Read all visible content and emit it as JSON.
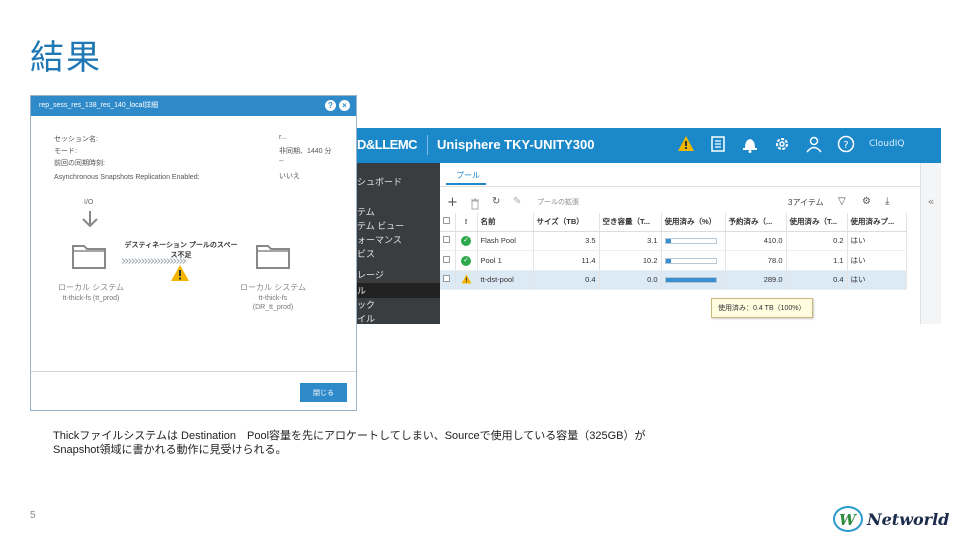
{
  "slide": {
    "title": "結果",
    "page_number": "5",
    "body_line1": "Thickファイルシステムは Destination　Pool容量を先にアロケートしてしまい、Sourceで使用している容量（325GB）が",
    "body_line2": "Snapshot領域に書かれる動作に見受けられる。",
    "logo_text": "Networld"
  },
  "dialog": {
    "title": "rep_sess_res_138_res_140_local詳細",
    "help_icon": "help-icon",
    "close_icon": "close-icon",
    "fields": [
      {
        "label": "セッション名:",
        "value": "r..."
      },
      {
        "label": "モード:",
        "value": "非同期、1440 分"
      },
      {
        "label": "前回の同期時刻:",
        "value": "--"
      },
      {
        "label": "Asynchronous Snapshots Replication Enabled:",
        "value": "いいえ"
      }
    ],
    "io_label": "I/O",
    "warning_line1": "デスティネーション プールのスペー",
    "warning_line2": "ス不足",
    "source": {
      "label": "ローカル システム",
      "fs": "tt-thick-fs (tt_prod)"
    },
    "destination": {
      "label": "ローカル システム",
      "fs": "tt-thick-fs",
      "fs2": "(DR_tt_prod)"
    },
    "close_button": "閉じる"
  },
  "unisphere": {
    "brand": "D&LLEMC",
    "product": "Unisphere TKY-UNITY300",
    "top_icons": [
      "warning-icon",
      "jobs-icon",
      "bell-icon",
      "gear-icon",
      "user-icon",
      "help-icon"
    ],
    "cloudiq": "CloudIQ",
    "sidebar": [
      "シュボード",
      "テム",
      "テム ビュー",
      "ォーマンス",
      "ビス",
      "レージ",
      "ル",
      "ック",
      "イル"
    ],
    "tab": "プール",
    "toolbar": {
      "expand_label": "プールの拡張",
      "items_count": "3アイテム"
    },
    "columns": [
      "!",
      "名前",
      "サイズ（TB）",
      "空き容量（T...",
      "使用済み（%）",
      "予約済み（...",
      "使用済み（T...",
      "使用済みプ..."
    ],
    "rows": [
      {
        "status": "ok",
        "name": "Flash Pool",
        "size": "3.5",
        "free": "3.1",
        "used_pct": 11,
        "reserved": "410.0",
        "used_tb": "0.2",
        "flag": "はい"
      },
      {
        "status": "ok",
        "name": "Pool 1",
        "size": "11.4",
        "free": "10.2",
        "used_pct": 10,
        "reserved": "78.0",
        "used_tb": "1.1",
        "flag": "はい"
      },
      {
        "status": "warn",
        "name": "tt-dst-pool",
        "size": "0.4",
        "free": "0.0",
        "used_pct": 100,
        "reserved": "289.0",
        "used_tb": "0.4",
        "flag": "はい"
      }
    ],
    "tooltip": "使用済み：0.4 TB（100%）",
    "colors": {
      "header": "#1b88c9",
      "sidebar": "#3a3d40",
      "ok": "#2da84a",
      "warn": "#f2b600"
    }
  }
}
